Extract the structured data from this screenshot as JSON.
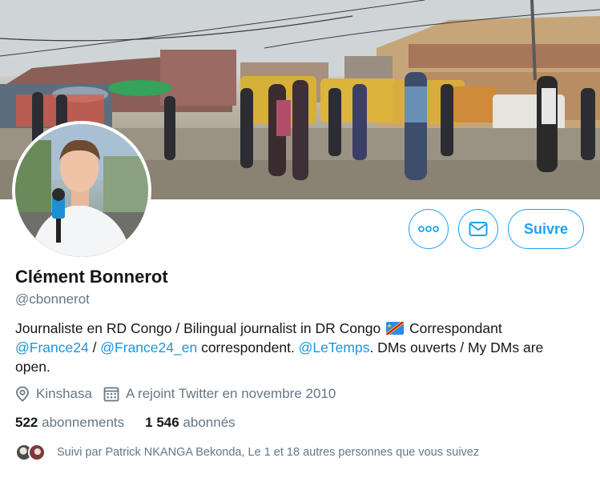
{
  "profile": {
    "name": "Clément Bonnerot",
    "handle": "@cbonnerot",
    "bio": {
      "part1": "Journaliste en RD Congo / Bilingual journalist in DR Congo",
      "part2": " Correspondant ",
      "mention1": "@France24",
      "sep": " / ",
      "mention2": "@France24_en",
      "part3": " correspondent. ",
      "mention3": "@LeTemps",
      "part4": ". DMs ouverts / My DMs are open."
    },
    "location": "Kinshasa",
    "joined": "A rejoint Twitter en novembre 2010",
    "following_count": "522",
    "following_label": "abonnements",
    "followers_count": "1 546",
    "followers_label": "abonnés",
    "followed_by": "Suivi par Patrick NKANGA Bekonda, Le 1 et 18 autres personnes que vous suivez"
  },
  "actions": {
    "more_icon": "more-icon",
    "message_icon": "envelope-icon",
    "follow_label": "Suivre"
  },
  "colors": {
    "accent": "#1da1f2",
    "link": "#1b95e0",
    "secondary_text": "#657786"
  }
}
